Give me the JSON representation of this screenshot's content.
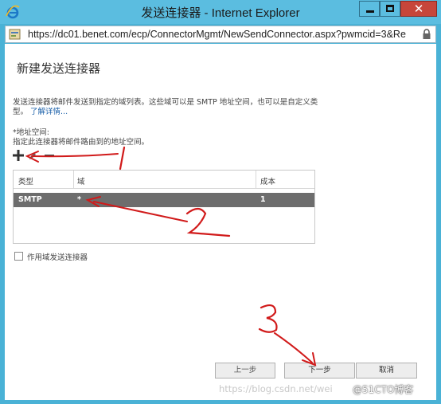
{
  "window": {
    "title": "发送连接器 - Internet Explorer",
    "url": "https://dc01.benet.com/ecp/ConnectorMgmt/NewSendConnector.aspx?pwmcid=3&Re"
  },
  "page": {
    "title": "新建发送连接器",
    "description": "发送连接器将邮件发送到指定的域列表。这些域可以是 SMTP 地址空间，也可以是自定义类型。",
    "learn_more": "了解详情...",
    "address_space_label": "*地址空间:",
    "address_space_hint": "指定此连接器将邮件路由到的地址空间。"
  },
  "grid": {
    "columns": [
      "类型",
      "域",
      "成本"
    ],
    "rows": [
      {
        "type": "SMTP",
        "domain": "*",
        "cost": "1"
      }
    ]
  },
  "checkbox": {
    "label": "作用域发送连接器",
    "checked": false
  },
  "buttons": {
    "prev": "上一步",
    "next": "下一步",
    "cancel": "取消"
  },
  "annotations": [
    "1",
    "2",
    "3"
  ],
  "watermark": {
    "left": "https://blog.csdn.net/wei",
    "right": "@51CTO博客"
  },
  "colors": {
    "titlebar": "#5bbde0",
    "close_button": "#c7463a",
    "selected_row": "#6d6d6d",
    "link": "#1a5fa8",
    "annotation": "#d11a1a"
  }
}
